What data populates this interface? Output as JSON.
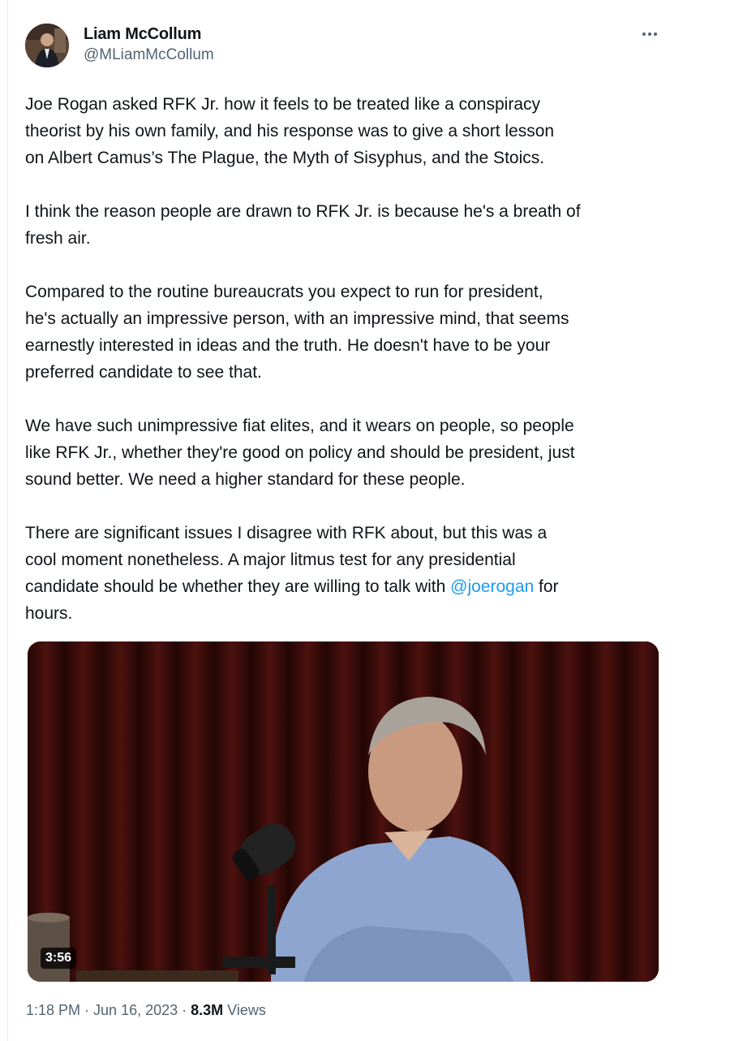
{
  "author": {
    "display_name": "Liam McCollum",
    "handle": "@MLiamMcCollum"
  },
  "more_icon": "ellipsis-icon",
  "tweet": {
    "p1": "Joe Rogan asked RFK Jr. how it feels to be treated like a conspiracy\ntheorist by his own family, and his response was to give a short lesson\non Albert Camus’s The Plague, the Myth of Sisyphus, and the Stoics.",
    "p2": "I think the reason people are drawn to RFK Jr. is because he's a breath of\nfresh air.",
    "p3": "Compared to the routine bureaucrats you expect to run for president,\nhe's actually an impressive person, with an impressive mind, that seems\nearnestly interested in ideas and the truth. He doesn't have to be your\npreferred candidate to see that.",
    "p4": "We have such unimpressive fiat elites, and it wears on people, so people\nlike RFK Jr., whether they're good on policy and should be president, just\nsound better. We need a higher standard for these people.",
    "p5_before": "There are significant issues I disagree with RFK about, but this was a\ncool moment nonetheless. A major litmus test for any presidential\ncandidate should be whether they are willing to talk with ",
    "mention": "@joerogan",
    "p5_after": " for\nhours."
  },
  "video": {
    "duration": "3:56"
  },
  "meta": {
    "time": "1:18 PM",
    "separator": " · ",
    "date": "Jun 16, 2023",
    "views_count": "8.3M",
    "views_label": " Views"
  }
}
